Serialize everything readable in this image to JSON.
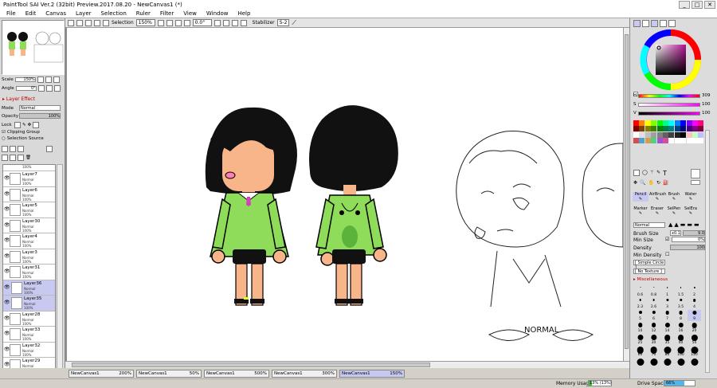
{
  "title": "PaintTool SAI Ver.2 (32bit) Preview.2017.08.20 - NewCanvas1 (*)",
  "window_buttons": {
    "min": "_",
    "max": "□",
    "close": "✕"
  },
  "menu": [
    "File",
    "Edit",
    "Canvas",
    "Layer",
    "Selection",
    "Ruler",
    "Filter",
    "View",
    "Window",
    "Help"
  ],
  "toolbar": {
    "selection_label": "Selection",
    "zoom": "150%",
    "angle": "0.0°",
    "stabilizer_label": "Stabilizer",
    "stabilizer_value": "S-2"
  },
  "navigator": {
    "scale_label": "Scale",
    "scale_value": "150%",
    "angle_label": "Angle",
    "angle_value": "0°"
  },
  "layer_effect": {
    "title": "Layer Effect",
    "mode_label": "Mode",
    "mode_value": "Normal",
    "opacity_label": "Opacity",
    "opacity_value": "100%",
    "lock_label": "Lock",
    "clipping_label": "Clipping Group",
    "selection_source_label": "Selection Source"
  },
  "layers": [
    {
      "name": "",
      "mode": "",
      "opacity": "100%",
      "selected": false
    },
    {
      "name": "Layer7",
      "mode": "Normal",
      "opacity": "100%",
      "selected": false
    },
    {
      "name": "Layer6",
      "mode": "Normal",
      "opacity": "100%",
      "selected": false
    },
    {
      "name": "Layer5",
      "mode": "Normal",
      "opacity": "100%",
      "selected": false
    },
    {
      "name": "Layer30",
      "mode": "Normal",
      "opacity": "100%",
      "selected": false
    },
    {
      "name": "Layer4",
      "mode": "Normal",
      "opacity": "100%",
      "selected": false
    },
    {
      "name": "Layer3",
      "mode": "Normal",
      "opacity": "100%",
      "selected": false
    },
    {
      "name": "Layer31",
      "mode": "Normal",
      "opacity": "100%",
      "selected": false
    },
    {
      "name": "Layer36",
      "mode": "Normal",
      "opacity": "100%",
      "selected": true
    },
    {
      "name": "Layer35",
      "mode": "Normal",
      "opacity": "100%",
      "selected": true
    },
    {
      "name": "Layer28",
      "mode": "Normal",
      "opacity": "100%",
      "selected": false
    },
    {
      "name": "Layer33",
      "mode": "Normal",
      "opacity": "100%",
      "selected": false
    },
    {
      "name": "Layer32",
      "mode": "Normal",
      "opacity": "100%",
      "selected": false
    },
    {
      "name": "Layer29",
      "mode": "Normal",
      "opacity": "100%",
      "selected": false
    }
  ],
  "tabs": [
    {
      "name": "NewCanvas1",
      "zoom": "200%",
      "active": false
    },
    {
      "name": "NewCanvas1",
      "zoom": "50%",
      "active": false
    },
    {
      "name": "NewCanvas1",
      "zoom": "500%",
      "active": false
    },
    {
      "name": "NewCanvas1",
      "zoom": "300%",
      "active": false
    },
    {
      "name": "NewCanvas1",
      "zoom": "150%",
      "active": true
    }
  ],
  "color": {
    "h_label": "H",
    "h_value": "309",
    "s_label": "S",
    "s_value": "100",
    "v_label": "V",
    "v_value": "100",
    "current": "#b0108f"
  },
  "tools": {
    "row1": [
      "Pencil",
      "AirBrush",
      "Brush",
      "Water"
    ],
    "row2": [
      "Marker",
      "Eraser",
      "SelPen",
      "SelEra"
    ]
  },
  "brush_props": {
    "blend_mode": "Normal",
    "brush_size_label": "Brush Size",
    "brush_size_mult": "x0.1",
    "brush_size_value": "9.0",
    "min_size_label": "Min Size",
    "min_size_value": "0%",
    "density_label": "Density",
    "density_value": "100",
    "min_density_label": "Min Density",
    "shape_label": "[ Simple Circle ]",
    "texture_label": "[ No Texture ]",
    "misc_label": "Miscellaneous"
  },
  "brush_sizes": [
    "0.6",
    "0.8",
    "1",
    "1.5",
    "2",
    "2.3",
    "2.6",
    "3",
    "3.5",
    "4",
    "5",
    "6",
    "7",
    "8",
    "9",
    "10",
    "12",
    "14",
    "16",
    "20",
    "25",
    "30",
    "35",
    "40",
    "50",
    "60",
    "70",
    "80",
    "100",
    "120",
    "",
    "",
    "",
    "",
    ""
  ],
  "canvas_text": "NORMAL",
  "status": {
    "memory_label": "Memory Usage",
    "memory_value": "13% (13%)",
    "drive_label": "Drive Space",
    "drive_value": "66%"
  }
}
